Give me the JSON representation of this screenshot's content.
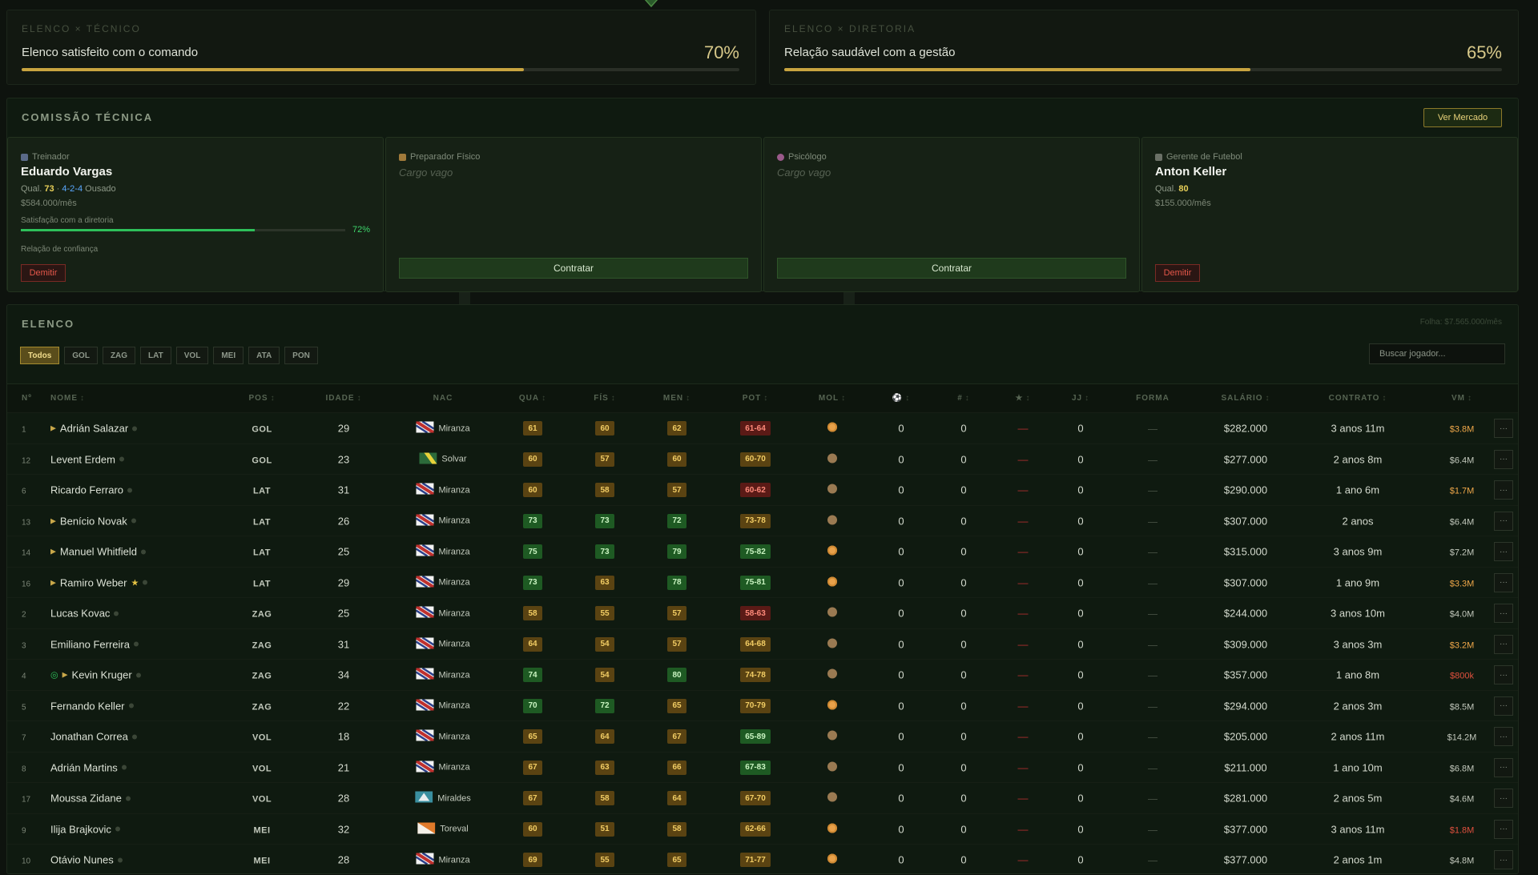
{
  "relations": [
    {
      "caption": "ELENCO × TÉCNICO",
      "text": "Elenco satisfeito com o comando",
      "pct_label": "70%",
      "pct": 70
    },
    {
      "caption": "ELENCO × DIRETORIA",
      "text": "Relação saudável com a gestão",
      "pct_label": "65%",
      "pct": 65
    }
  ],
  "staff": {
    "title": "COMISSÃO TÉCNICA",
    "market_button": "Ver Mercado",
    "coach": {
      "role": "Treinador",
      "name": "Eduardo Vargas",
      "qual_label": "Qual.",
      "qual": "73",
      "formation": "4-2-4",
      "style": "Ousado",
      "salary": "$584.000/mês",
      "sat_label": "Satisfação com a diretoria",
      "sat_pct_label": "72%",
      "sat_pct": 72,
      "trust_label": "Relação de confiança",
      "fire": "Demitir"
    },
    "fitness": {
      "role": "Preparador Físico",
      "vacant": "Cargo vago",
      "hire": "Contratar"
    },
    "psych": {
      "role": "Psicólogo",
      "vacant": "Cargo vago",
      "hire": "Contratar"
    },
    "manager": {
      "role": "Gerente de Futebol",
      "name": "Anton Keller",
      "qual_label": "Qual.",
      "qual": "80",
      "salary": "$155.000/mês",
      "fire": "Demitir"
    }
  },
  "squad": {
    "title": "ELENCO",
    "payroll": "Folha: $7.565.000/mês",
    "filters": [
      "Todos",
      "GOL",
      "ZAG",
      "LAT",
      "VOL",
      "MEI",
      "ATA",
      "PON"
    ],
    "search_placeholder": "Buscar jogador...",
    "headers": {
      "num": "Nº",
      "name": "NOME",
      "pos": "POS",
      "age": "IDADE",
      "nat": "NAC",
      "qua": "QUA",
      "fis": "FÍS",
      "men": "MEN",
      "pot": "POT",
      "mor": "MOL",
      "goals": "⚽",
      "assists": "#",
      "rating": "★",
      "games": "JJ",
      "form": "FORMA",
      "salary": "SALÁRIO",
      "contract": "CONTRATO",
      "value": "VM"
    },
    "players": [
      {
        "num": "1",
        "name": "Adrián Salazar",
        "arrow": true,
        "star": false,
        "bolt": false,
        "pos": "GOL",
        "age": "29",
        "nat": "Miranza",
        "flag": "miranza",
        "qua": "61",
        "fis": "60",
        "men": "62",
        "pot": "61-64",
        "pot_c": "red",
        "mood": "happy",
        "goals": "0",
        "assists": "0",
        "rating": "—",
        "games": "0",
        "form": "—",
        "salary": "$282.000",
        "contract": "3 anos 11m",
        "value": "$3.8M",
        "value_c": "orange"
      },
      {
        "num": "12",
        "name": "Levent Erdem",
        "arrow": false,
        "star": false,
        "bolt": false,
        "pos": "GOL",
        "age": "23",
        "nat": "Solvar",
        "flag": "solvar",
        "qua": "60",
        "fis": "57",
        "men": "60",
        "pot": "60-70",
        "pot_c": "amber",
        "mood": "neutral",
        "goals": "0",
        "assists": "0",
        "rating": "—",
        "games": "0",
        "form": "—",
        "salary": "$277.000",
        "contract": "2 anos 8m",
        "value": "$6.4M",
        "value_c": "white"
      },
      {
        "num": "6",
        "name": "Ricardo Ferraro",
        "arrow": false,
        "star": false,
        "bolt": false,
        "pos": "LAT",
        "age": "31",
        "nat": "Miranza",
        "flag": "miranza",
        "qua": "60",
        "fis": "58",
        "men": "57",
        "pot": "60-62",
        "pot_c": "red",
        "mood": "neutral",
        "goals": "0",
        "assists": "0",
        "rating": "—",
        "games": "0",
        "form": "—",
        "salary": "$290.000",
        "contract": "1 ano 6m",
        "value": "$1.7M",
        "value_c": "orange"
      },
      {
        "num": "13",
        "name": "Benício Novak",
        "arrow": true,
        "star": false,
        "bolt": false,
        "pos": "LAT",
        "age": "26",
        "nat": "Miranza",
        "flag": "miranza",
        "qua": "73",
        "fis": "73",
        "men": "72",
        "pot": "73-78",
        "pot_c": "amber",
        "mood": "neutral",
        "goals": "0",
        "assists": "0",
        "rating": "—",
        "games": "0",
        "form": "—",
        "salary": "$307.000",
        "contract": "2 anos",
        "value": "$6.4M",
        "value_c": "white"
      },
      {
        "num": "14",
        "name": "Manuel Whitfield",
        "arrow": true,
        "star": false,
        "bolt": false,
        "pos": "LAT",
        "age": "25",
        "nat": "Miranza",
        "flag": "miranza",
        "qua": "75",
        "fis": "73",
        "men": "79",
        "pot": "75-82",
        "pot_c": "green",
        "mood": "happy",
        "goals": "0",
        "assists": "0",
        "rating": "—",
        "games": "0",
        "form": "—",
        "salary": "$315.000",
        "contract": "3 anos 9m",
        "value": "$7.2M",
        "value_c": "white"
      },
      {
        "num": "16",
        "name": "Ramiro Weber",
        "arrow": true,
        "star": true,
        "bolt": false,
        "pos": "LAT",
        "age": "29",
        "nat": "Miranza",
        "flag": "miranza",
        "qua": "73",
        "fis": "63",
        "men": "78",
        "pot": "75-81",
        "pot_c": "green",
        "mood": "happy",
        "goals": "0",
        "assists": "0",
        "rating": "—",
        "games": "0",
        "form": "—",
        "salary": "$307.000",
        "contract": "1 ano 9m",
        "value": "$3.3M",
        "value_c": "orange"
      },
      {
        "num": "2",
        "name": "Lucas Kovac",
        "arrow": false,
        "star": false,
        "bolt": false,
        "pos": "ZAG",
        "age": "25",
        "nat": "Miranza",
        "flag": "miranza",
        "qua": "58",
        "fis": "55",
        "men": "57",
        "pot": "58-63",
        "pot_c": "red",
        "mood": "neutral",
        "goals": "0",
        "assists": "0",
        "rating": "—",
        "games": "0",
        "form": "—",
        "salary": "$244.000",
        "contract": "3 anos 10m",
        "value": "$4.0M",
        "value_c": "white"
      },
      {
        "num": "3",
        "name": "Emiliano Ferreira",
        "arrow": false,
        "star": false,
        "bolt": false,
        "pos": "ZAG",
        "age": "31",
        "nat": "Miranza",
        "flag": "miranza",
        "qua": "64",
        "fis": "54",
        "men": "57",
        "pot": "64-68",
        "pot_c": "amber",
        "mood": "neutral",
        "goals": "0",
        "assists": "0",
        "rating": "—",
        "games": "0",
        "form": "—",
        "salary": "$309.000",
        "contract": "3 anos 3m",
        "value": "$3.2M",
        "value_c": "orange"
      },
      {
        "num": "4",
        "name": "Kevin Kruger",
        "arrow": true,
        "star": false,
        "bolt": true,
        "pos": "ZAG",
        "age": "34",
        "nat": "Miranza",
        "flag": "miranza",
        "qua": "74",
        "fis": "54",
        "men": "80",
        "pot": "74-78",
        "pot_c": "amber",
        "mood": "neutral",
        "goals": "0",
        "assists": "0",
        "rating": "—",
        "games": "0",
        "form": "—",
        "salary": "$357.000",
        "contract": "1 ano 8m",
        "value": "$800k",
        "value_c": "red"
      },
      {
        "num": "5",
        "name": "Fernando Keller",
        "arrow": false,
        "star": false,
        "bolt": false,
        "pos": "ZAG",
        "age": "22",
        "nat": "Miranza",
        "flag": "miranza",
        "qua": "70",
        "fis": "72",
        "men": "65",
        "pot": "70-79",
        "pot_c": "amber",
        "mood": "happy",
        "goals": "0",
        "assists": "0",
        "rating": "—",
        "games": "0",
        "form": "—",
        "salary": "$294.000",
        "contract": "2 anos 3m",
        "value": "$8.5M",
        "value_c": "white"
      },
      {
        "num": "7",
        "name": "Jonathan Correa",
        "arrow": false,
        "star": false,
        "bolt": false,
        "pos": "VOL",
        "age": "18",
        "nat": "Miranza",
        "flag": "miranza",
        "qua": "65",
        "fis": "64",
        "men": "67",
        "pot": "65-89",
        "pot_c": "green",
        "mood": "neutral",
        "goals": "0",
        "assists": "0",
        "rating": "—",
        "games": "0",
        "form": "—",
        "salary": "$205.000",
        "contract": "2 anos 11m",
        "value": "$14.2M",
        "value_c": "white"
      },
      {
        "num": "8",
        "name": "Adrián Martins",
        "arrow": false,
        "star": false,
        "bolt": false,
        "pos": "VOL",
        "age": "21",
        "nat": "Miranza",
        "flag": "miranza",
        "qua": "67",
        "fis": "63",
        "men": "66",
        "pot": "67-83",
        "pot_c": "green",
        "mood": "neutral",
        "goals": "0",
        "assists": "0",
        "rating": "—",
        "games": "0",
        "form": "—",
        "salary": "$211.000",
        "contract": "1 ano 10m",
        "value": "$6.8M",
        "value_c": "white"
      },
      {
        "num": "17",
        "name": "Moussa Zidane",
        "arrow": false,
        "star": false,
        "bolt": false,
        "pos": "VOL",
        "age": "28",
        "nat": "Miraldes",
        "flag": "miraldes",
        "qua": "67",
        "fis": "58",
        "men": "64",
        "pot": "67-70",
        "pot_c": "amber",
        "mood": "neutral",
        "goals": "0",
        "assists": "0",
        "rating": "—",
        "games": "0",
        "form": "—",
        "salary": "$281.000",
        "contract": "2 anos 5m",
        "value": "$4.6M",
        "value_c": "white"
      },
      {
        "num": "9",
        "name": "Ilija Brajkovic",
        "arrow": false,
        "star": false,
        "bolt": false,
        "pos": "MEI",
        "age": "32",
        "nat": "Toreval",
        "flag": "toreval",
        "qua": "60",
        "fis": "51",
        "men": "58",
        "pot": "62-66",
        "pot_c": "amber",
        "mood": "happy",
        "goals": "0",
        "assists": "0",
        "rating": "—",
        "games": "0",
        "form": "—",
        "salary": "$377.000",
        "contract": "3 anos 11m",
        "value": "$1.8M",
        "value_c": "red"
      },
      {
        "num": "10",
        "name": "Otávio Nunes",
        "arrow": false,
        "star": false,
        "bolt": false,
        "pos": "MEI",
        "age": "28",
        "nat": "Miranza",
        "flag": "miranza",
        "qua": "69",
        "fis": "55",
        "men": "65",
        "pot": "71-77",
        "pot_c": "amber",
        "mood": "happy",
        "goals": "0",
        "assists": "0",
        "rating": "—",
        "games": "0",
        "form": "—",
        "salary": "$377.000",
        "contract": "2 anos 1m",
        "value": "$4.8M",
        "value_c": "white"
      }
    ]
  }
}
